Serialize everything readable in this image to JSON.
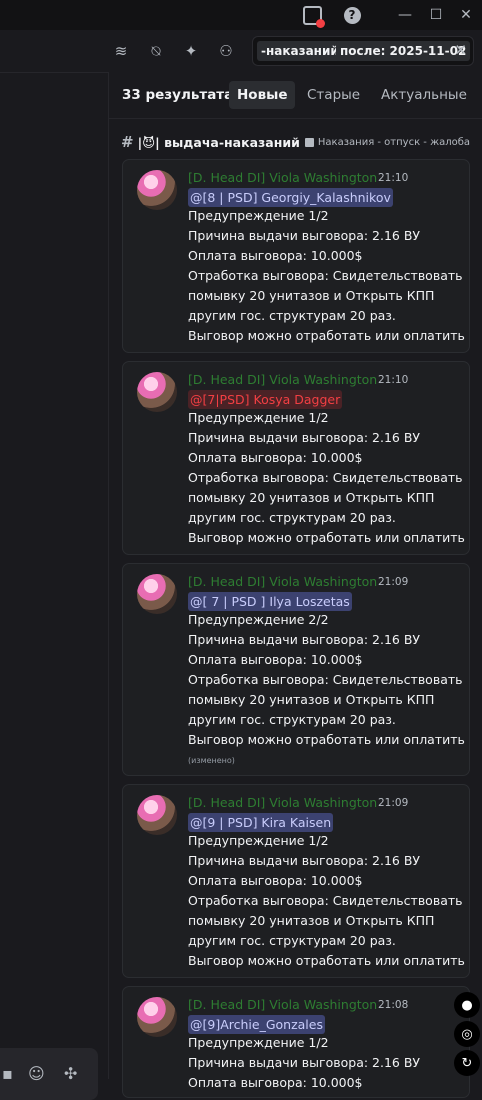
{
  "window": {
    "minimize_icon": "—",
    "maximize_icon": "☐",
    "close_icon": "✕",
    "help_icon": "?"
  },
  "search": {
    "chip_channel": "-наказаний",
    "chip_after": "после: 2025-11-02",
    "clear_icon": "✕"
  },
  "results": {
    "count_label": "33 результата",
    "tabs": [
      "Новые",
      "Старые",
      "Актуальные"
    ],
    "active_tab": "Новые"
  },
  "channel": {
    "name": "|😈| выдача-наказаний",
    "emoji": "😈",
    "forum": "Наказания - отпуск - жалоба"
  },
  "messages": [
    {
      "author": "[D. Head DI] Viola Washington",
      "time": "21:10",
      "mention": "@[8 | PSD] Georgiy_Kalashnikov",
      "mention_color": "blue",
      "lines": [
        "Предупреждение 1/2",
        "Причина выдачи выговора: 2.16 ВУ",
        "Оплата выговора: 10.000$",
        "Отработка выговора: Свидетельствовать",
        "помывку 20 унитазов и Открыть КПП",
        "другим гос. структурам 20 раз.",
        "Выговор можно отработать или оплатить"
      ]
    },
    {
      "author": "[D. Head DI] Viola Washington",
      "time": "21:10",
      "mention": "@[7|PSD] Kosya Dagger",
      "mention_color": "red",
      "lines": [
        "Предупреждение 1/2",
        "Причина выдачи выговора: 2.16 ВУ",
        "Оплата выговора: 10.000$",
        "Отработка выговора: Свидетельствовать",
        "помывку 20 унитазов и Открыть КПП",
        "другим гос. структурам 20 раз.",
        "Выговор можно отработать или оплатить"
      ]
    },
    {
      "author": "[D. Head DI] Viola Washington",
      "time": "21:09",
      "mention": "@[ 7 | PSD ] Ilya Loszetas",
      "mention_color": "blue",
      "lines": [
        "Предупреждение 2/2",
        "Причина выдачи выговора: 2.16 ВУ",
        "Оплата выговора: 10.000$",
        "Отработка выговора: Свидетельствовать",
        "помывку 20 унитазов и Открыть КПП",
        "другим гос. структурам 20 раз.",
        "Выговор можно отработать или оплатить"
      ],
      "edited": "(изменено)"
    },
    {
      "author": "[D. Head DI] Viola Washington",
      "time": "21:09",
      "mention": "@[9 | PSD] Kira Kaisen",
      "mention_color": "blue",
      "lines": [
        "Предупреждение 1/2",
        "Причина выдачи выговора: 2.16 ВУ",
        "Оплата выговора: 10.000$",
        "Отработка выговора: Свидетельствовать",
        "помывку 20 унитазов и Открыть КПП",
        "другим гос. структурам 20 раз.",
        "Выговор можно отработать или оплатить"
      ]
    },
    {
      "author": "[D. Head DI] Viola Washington",
      "time": "21:08",
      "mention": "@[9]Archie_Gonzales",
      "mention_color": "blue",
      "lines": [
        "Предупреждение 1/2",
        "Причина выдачи выговора: 2.16 ВУ",
        "Оплата выговора: 10.000$"
      ]
    }
  ],
  "colors": {
    "author": "#2e7d32",
    "mention_blue": "#c9cdfb",
    "mention_red": "#f23f43",
    "card_bg": "#1e1f22",
    "panel_bg": "#1a1a1e"
  }
}
